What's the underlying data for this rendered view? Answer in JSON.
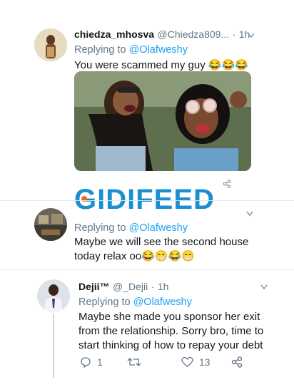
{
  "tweet1": {
    "display_name": "chiedza_mhosva",
    "handle": "@Chiedza809...",
    "dot": "·",
    "time": "1h",
    "replying_prefix": "Replying to",
    "replying_to": "@Olafweshy",
    "text": "You were scammed my guy",
    "emoji": "😂😂😂"
  },
  "watermark": {
    "text": "GIDIFEED",
    "color": "#1a8fd1",
    "accent": "#f26522"
  },
  "tweet2": {
    "replying_prefix": "Replying to",
    "replying_to": "@Olafweshy",
    "text_line1": "Maybe we will see the second house",
    "text_line2": "today relax oo",
    "emoji": "😂😁😂😁"
  },
  "tweet3": {
    "display_name": "Dejii™",
    "handle": "@_Dejii",
    "dot": "·",
    "time": "1h",
    "replying_prefix": "Replying to",
    "replying_to": "@Olafweshy",
    "text_line1": "Maybe she made you sponsor her exit",
    "text_line2": "from the relationship. Sorry bro, time to",
    "text_line3": "start thinking of how to repay your debt",
    "reply_count": "1",
    "like_count": "13"
  }
}
